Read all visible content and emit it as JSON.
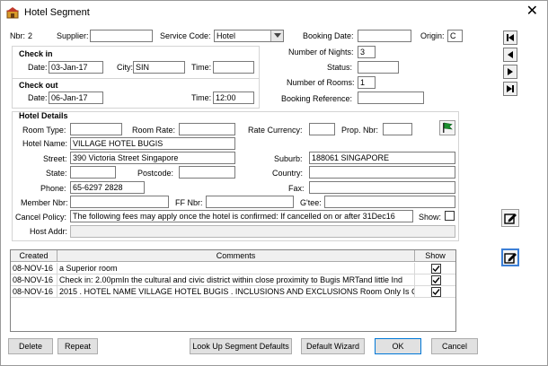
{
  "window": {
    "title": "Hotel Segment"
  },
  "header": {
    "nbr_label": "Nbr:",
    "nbr_value": "2",
    "supplier_label": "Supplier:",
    "supplier_value": "",
    "service_code_label": "Service Code:",
    "service_code_value": "Hotel",
    "booking_date_label": "Booking Date:",
    "booking_date_value": "",
    "origin_label": "Origin:",
    "origin_value": "C"
  },
  "checkin": {
    "heading": "Check in",
    "date_label": "Date:",
    "date_value": "03-Jan-17",
    "city_label": "City:",
    "city_value": "SIN",
    "time_label": "Time:",
    "time_value": ""
  },
  "checkout": {
    "heading": "Check out",
    "date_label": "Date:",
    "date_value": "06-Jan-17",
    "time_label": "Time:",
    "time_value": "12:00"
  },
  "right_fields": {
    "nights_label": "Number of Nights:",
    "nights_value": "3",
    "status_label": "Status:",
    "status_value": "",
    "rooms_label": "Number of Rooms:",
    "rooms_value": "1",
    "booking_ref_label": "Booking Reference:",
    "booking_ref_value": ""
  },
  "hotel": {
    "heading": "Hotel Details",
    "room_type_label": "Room Type:",
    "room_type_value": "",
    "room_rate_label": "Room Rate:",
    "room_rate_value": "",
    "rate_currency_label": "Rate Currency:",
    "rate_currency_value": "",
    "prop_nbr_label": "Prop. Nbr:",
    "prop_nbr_value": "",
    "hotel_name_label": "Hotel Name:",
    "hotel_name_value": "VILLAGE HOTEL BUGIS",
    "street_label": "Street:",
    "street_value": "390 Victoria Street Singapore",
    "suburb_label": "Suburb:",
    "suburb_value": "188061 SINGAPORE",
    "state_label": "State:",
    "state_value": "",
    "postcode_label": "Postcode:",
    "postcode_value": "",
    "country_label": "Country:",
    "country_value": "",
    "phone_label": "Phone:",
    "phone_value": "65-6297 2828",
    "fax_label": "Fax:",
    "fax_value": ""
  },
  "member": {
    "member_nbr_label": "Member Nbr:",
    "member_nbr_value": "",
    "ff_nbr_label": "FF Nbr:",
    "ff_nbr_value": "",
    "gtee_label": "G'tee:",
    "gtee_value": ""
  },
  "cancel_policy": {
    "label": "Cancel Policy:",
    "value": "The following fees may apply once the hotel is confirmed:  If cancelled on or after 31Dec16",
    "show_label": "Show:",
    "show_checked": false
  },
  "host_addr": {
    "label": "Host Addr:",
    "value": ""
  },
  "comments_table": {
    "columns": [
      "Created",
      "Comments",
      "Show"
    ],
    "rows": [
      {
        "created": "08-NOV-16",
        "comment": "a Superior room",
        "show": true
      },
      {
        "created": "08-NOV-16",
        "comment": "Check in: 2.00pmIn the cultural and civic district within close proximity to Bugis MRTand little Ind",
        "show": true
      },
      {
        "created": "08-NOV-16",
        "comment": "2015 . HOTEL NAME VILLAGE HOTEL BUGIS . INCLUSIONS AND EXCLUSIONS Room Only Is C",
        "show": true
      }
    ]
  },
  "buttons": {
    "delete": "Delete",
    "repeat": "Repeat",
    "lookup": "Look Up Segment Defaults",
    "default_wizard": "Default Wizard",
    "ok": "OK",
    "cancel": "Cancel"
  },
  "colors": {
    "flag": "#1a8f2e",
    "focus_border": "#3c7fd6"
  }
}
